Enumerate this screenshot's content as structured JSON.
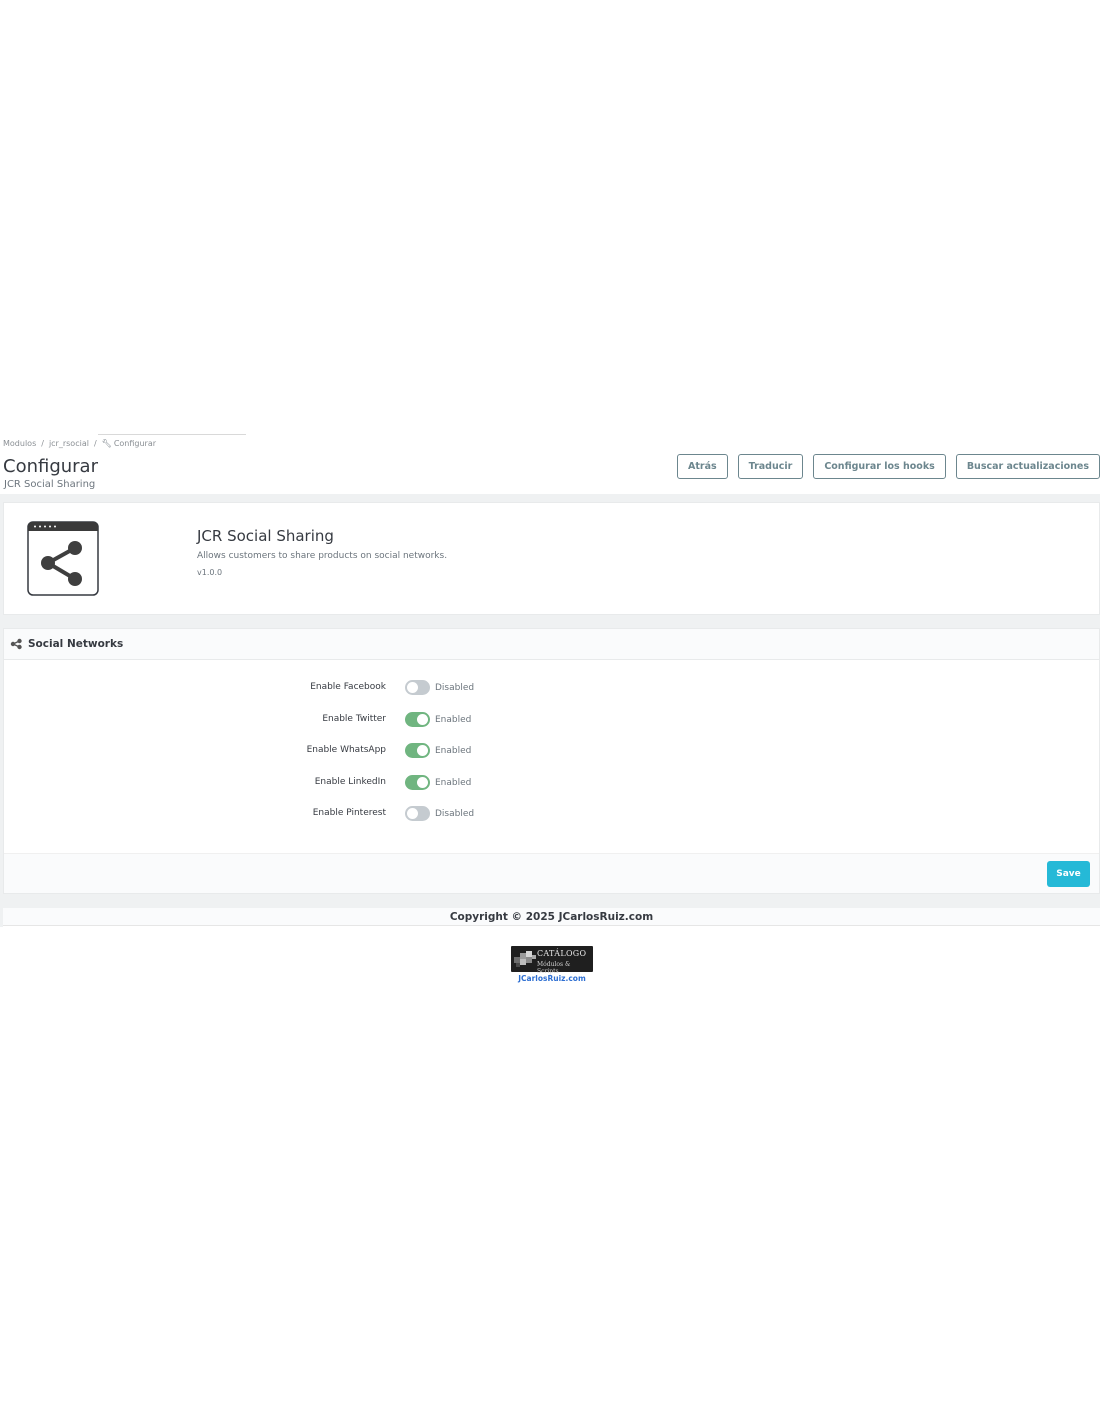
{
  "breadcrumb": {
    "items": [
      "Modulos",
      "jcr_rsocial",
      "Configurar"
    ]
  },
  "header": {
    "title": "Configurar",
    "subtitle": "JCR Social Sharing"
  },
  "toolbar": {
    "buttons": [
      "Atrás",
      "Traducir",
      "Configurar los hooks",
      "Buscar actualizaciones"
    ]
  },
  "module": {
    "name": "JCR Social Sharing",
    "description": "Allows customers to share products on social networks.",
    "version": "v1.0.0"
  },
  "panel": {
    "title": "Social Networks",
    "rows": [
      {
        "label": "Enable Facebook",
        "enabled": false,
        "state": "Disabled"
      },
      {
        "label": "Enable Twitter",
        "enabled": true,
        "state": "Enabled"
      },
      {
        "label": "Enable WhatsApp",
        "enabled": true,
        "state": "Enabled"
      },
      {
        "label": "Enable LinkedIn",
        "enabled": true,
        "state": "Enabled"
      },
      {
        "label": "Enable Pinterest",
        "enabled": false,
        "state": "Disabled"
      }
    ],
    "save_label": "Save"
  },
  "footer": {
    "copyright": "Copyright © 2025 JCarlosRuiz.com",
    "logo_title": "Catálogo",
    "logo_subtitle": "Módulos & Scripts",
    "logo_link": "JCarlosRuiz.com"
  },
  "colors": {
    "accent": "#25b9d7",
    "switch_on": "#70b580",
    "switch_off": "#c5cbd0"
  }
}
